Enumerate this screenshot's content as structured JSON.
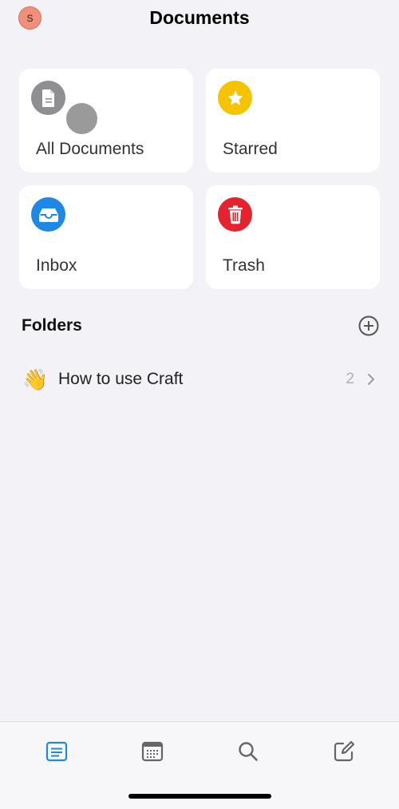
{
  "header": {
    "avatar_initial": "S",
    "title": "Documents"
  },
  "cards": {
    "all_documents": {
      "label": "All Documents",
      "icon": "document-icon",
      "color": "#8e8e93"
    },
    "starred": {
      "label": "Starred",
      "icon": "star-icon",
      "color": "#f5c400"
    },
    "inbox": {
      "label": "Inbox",
      "icon": "inbox-tray-icon",
      "color": "#1e88e5"
    },
    "trash": {
      "label": "Trash",
      "icon": "trash-icon",
      "color": "#e5232f"
    }
  },
  "folders": {
    "heading": "Folders",
    "add_icon": "plus-circle-icon",
    "items": [
      {
        "emoji": "👋",
        "name": "How to use Craft",
        "count": "2"
      }
    ]
  },
  "tab_bar": {
    "items": [
      {
        "name": "documents",
        "icon": "documents-list-icon",
        "active": true,
        "color": "#1e88e5"
      },
      {
        "name": "calendar",
        "icon": "calendar-icon",
        "active": false,
        "color": "#666666"
      },
      {
        "name": "search",
        "icon": "search-icon",
        "active": false,
        "color": "#666666"
      },
      {
        "name": "compose",
        "icon": "compose-icon",
        "active": false,
        "color": "#666666"
      }
    ]
  }
}
